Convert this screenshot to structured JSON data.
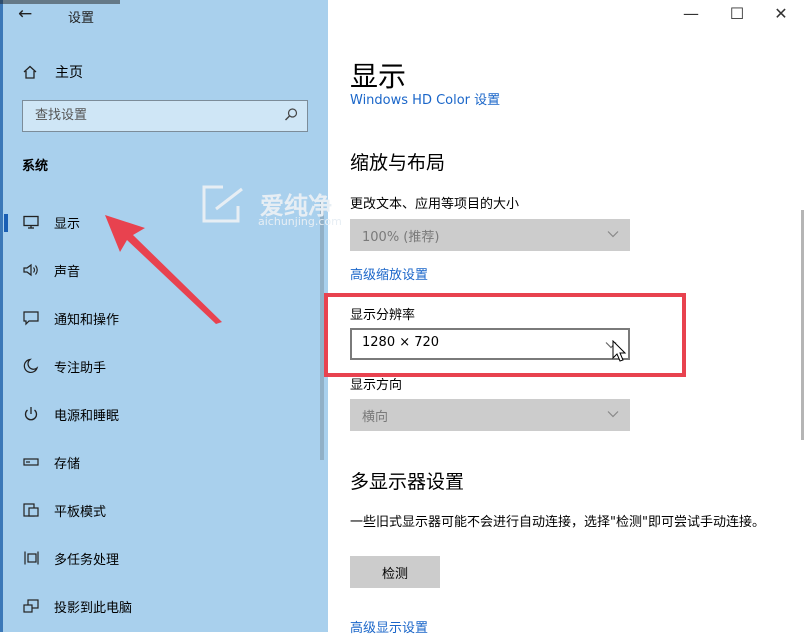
{
  "window": {
    "app_title": "设置",
    "back_glyph": "←",
    "minimize_glyph": "—",
    "maximize_glyph": "☐",
    "close_glyph": "✕"
  },
  "sidebar": {
    "home_label": "主页",
    "search_placeholder": "查找设置",
    "section_title": "系统",
    "items": [
      {
        "label": "显示",
        "icon": "monitor-icon",
        "active": true
      },
      {
        "label": "声音",
        "icon": "speaker-icon"
      },
      {
        "label": "通知和操作",
        "icon": "notification-icon"
      },
      {
        "label": "专注助手",
        "icon": "moon-icon"
      },
      {
        "label": "电源和睡眠",
        "icon": "power-icon"
      },
      {
        "label": "存储",
        "icon": "storage-icon"
      },
      {
        "label": "平板模式",
        "icon": "tablet-icon"
      },
      {
        "label": "多任务处理",
        "icon": "multitask-icon"
      },
      {
        "label": "投影到此电脑",
        "icon": "project-icon"
      }
    ],
    "colors": {
      "background": "#a9d0ed",
      "accent": "#1a5fb4"
    }
  },
  "main": {
    "page_title": "显示",
    "hdr_link": "Windows HD Color 设置",
    "scale_heading": "缩放与布局",
    "scale_label": "更改文本、应用等项目的大小",
    "scale_value": "100% (推荐)",
    "adv_scale_link": "高级缩放设置",
    "resolution_label": "显示分辨率",
    "resolution_value": "1280 × 720",
    "orientation_label": "显示方向",
    "orientation_value": "横向",
    "multi_heading": "多显示器设置",
    "multi_desc": "一些旧式显示器可能不会进行自动连接，选择\"检测\"即可尝试手动连接。",
    "detect_button": "检测",
    "adv_display_link": "高级显示设置"
  },
  "watermark": {
    "text": "爱纯净",
    "url": "aichunjing.com"
  },
  "annotation_colors": {
    "highlight": "#e8424f"
  }
}
